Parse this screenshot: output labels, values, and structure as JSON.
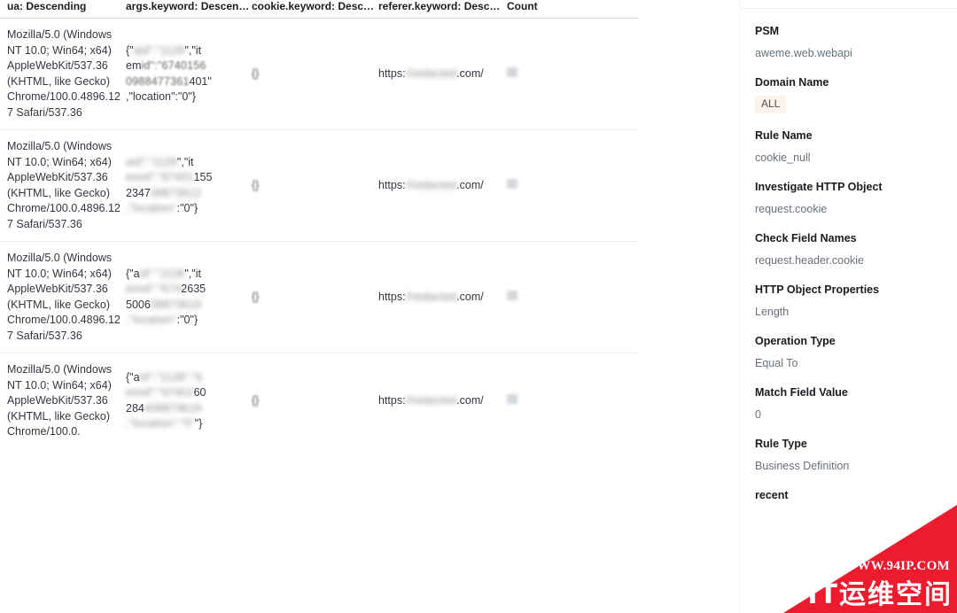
{
  "table": {
    "columns": [
      {
        "id": "ua",
        "label": "ua: Descending"
      },
      {
        "id": "args",
        "label": "args.keyword: Descen…"
      },
      {
        "id": "cookie",
        "label": "cookie.keyword: Desc…"
      },
      {
        "id": "referer",
        "label": "referer.keyword: Desc…"
      },
      {
        "id": "count",
        "label": "Count"
      }
    ],
    "rows": [
      {
        "ua": "Mozilla/5.0 (Windows NT 10.0; Win64; x64) AppleWebKit/537.36 (KHTML, like Gecko) Chrome/100.0.4896.127 Safari/537.36",
        "args_prefix": "{\"",
        "args_redacted_1": "aid\":\"1128",
        "args_mid_1": "\",\"it",
        "args_line2_pre": "em",
        "args_redacted_2": "id\":\"67401",
        "args_redacted_3": "56",
        "args_line3_redacted": "0988477361",
        "args_line3_visible": "401\"",
        "args_tail": ",\"location\":\"0\"}",
        "cookie": "{}",
        "referer_prefix": "https:",
        "referer_redacted": "//redacted",
        "referer_suffix": ".com/",
        "count": ""
      },
      {
        "ua": "Mozilla/5.0 (Windows NT 10.0; Win64; x64) AppleWebKit/537.36 (KHTML, like Gecko) Chrome/100.0.4896.127 Safari/537.36",
        "args_prefix": "{\"",
        "args_redacted_1": "aid\":\"1128",
        "args_mid_1": "\",\"it",
        "args_line2_pre": "",
        "args_redacted_2": "emid\":\"67401",
        "args_redacted_3": "",
        "args_line2_visible": "155",
        "args_line3_visible": "2347",
        "args_line3_redacted": "08873612",
        "args_tail_redacted": ",\"location\"",
        "args_tail": ":\"0\"}",
        "cookie": "{}",
        "referer_prefix": "https:",
        "referer_redacted": "//redacted",
        "referer_suffix": ".com/",
        "count": ""
      },
      {
        "ua": "Mozilla/5.0 (Windows NT 10.0; Win64; x64) AppleWebKit/537.36 (KHTML, like Gecko) Chrome/100.0.4896.127 Safari/537.36",
        "args_prefix": "{\"a",
        "args_redacted_1": "id\":\"1128",
        "args_mid_1": "\",\"it",
        "args_redacted_2": "emid\":\"674",
        "args_line2_visible": "2635",
        "args_line3_visible": "5006",
        "args_line3_redacted": "08873619",
        "args_tail_redacted": ",\"location\"",
        "args_tail": ":\"0\"}",
        "cookie": "{}",
        "referer_prefix": "https:",
        "referer_redacted": "//redacted",
        "referer_suffix": ".com/",
        "count": ""
      },
      {
        "ua": "Mozilla/5.0 (Windows NT 10.0; Win64; x64) AppleWebKit/537.36 (KHTML, like Gecko) Chrome/100.0.",
        "args_prefix": "{\"a",
        "args_redacted_1": "id\":\"1128\",\"it",
        "args_redacted_2": "emid\":\"67401",
        "args_line2_visible": "60",
        "args_line3_visible": "284",
        "args_line3_redacted": "408873619",
        "args_tail_redacted": ",\"location\":\"0\"",
        "args_tail": "\"}",
        "cookie": "{}",
        "referer_prefix": "https:",
        "referer_redacted": "//redacted",
        "referer_suffix": ".com/",
        "count": ""
      }
    ]
  },
  "detail": {
    "fields": [
      {
        "label": "PSM",
        "value": "aweme.web.webapi",
        "type": "text"
      },
      {
        "label": "Domain Name",
        "value": "ALL",
        "type": "badge"
      },
      {
        "label": "Rule Name",
        "value": "cookie_null",
        "type": "text"
      },
      {
        "label": "Investigate HTTP Object",
        "value": "request.cookie",
        "type": "text"
      },
      {
        "label": "Check Field Names",
        "value": "request.header.cookie",
        "type": "text"
      },
      {
        "label": "HTTP Object Properties",
        "value": "Length",
        "type": "text"
      },
      {
        "label": "Operation Type",
        "value": "Equal To",
        "type": "text"
      },
      {
        "label": "Match Field Value",
        "value": "0",
        "type": "text"
      },
      {
        "label": "Rule Type",
        "value": "Business Definition",
        "type": "text"
      }
    ],
    "truncated_label": "recent"
  },
  "watermark": {
    "url_text": "WWW.94IP.COM",
    "brand_text": "IT运维空间",
    "color": "#ED1B2E"
  }
}
